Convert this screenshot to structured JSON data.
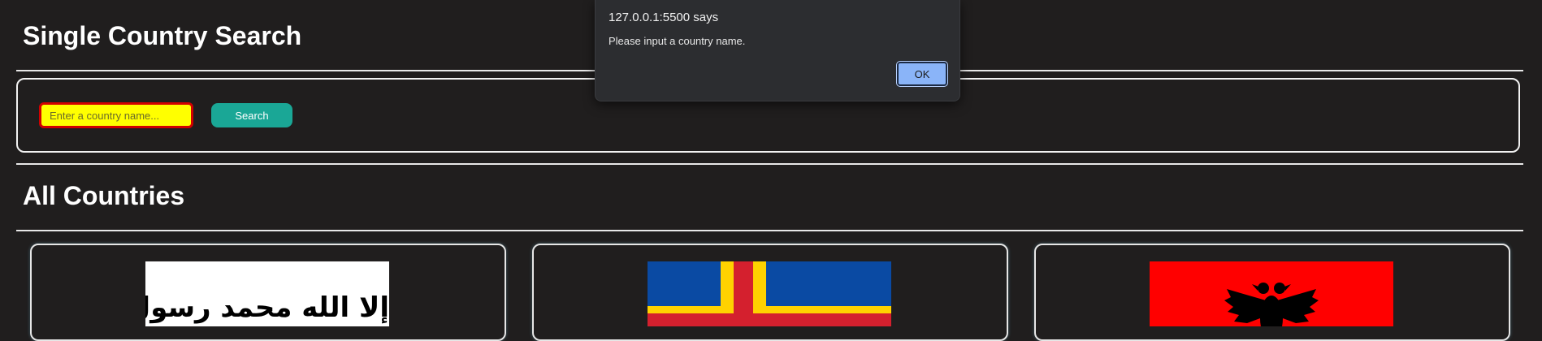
{
  "single_search": {
    "title": "Single Country Search",
    "input_placeholder": "Enter a country name...",
    "input_value": "",
    "search_label": "Search"
  },
  "all_countries": {
    "title": "All Countries",
    "cards": [
      {
        "flag": "afghanistan-flag",
        "flag_text": "لا إله إلا الله محمد رسول الله"
      },
      {
        "flag": "aland-islands-flag"
      },
      {
        "flag": "albania-flag"
      }
    ]
  },
  "alert": {
    "title": "127.0.0.1:5500 says",
    "message": "Please input a country name.",
    "ok_label": "OK"
  },
  "colors": {
    "background": "#201e1e",
    "search_button": "#1aa796",
    "input_background": "#ffff00",
    "input_border": "#d10000",
    "dialog_background": "#2c2d30",
    "dialog_ok": "#8ab4f8"
  }
}
